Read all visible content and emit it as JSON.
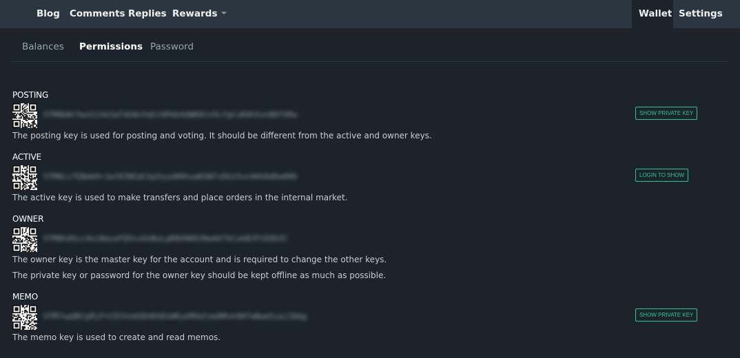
{
  "topnav": {
    "blog": "Blog",
    "comments": "Comments",
    "replies": "Replies",
    "rewards": "Rewards",
    "wallet": "Wallet",
    "settings": "Settings"
  },
  "subnav": {
    "balances": "Balances",
    "permissions": "Permissions",
    "password": "Password"
  },
  "keys": {
    "posting": {
      "title": "POSTING",
      "public_key": "STM8bWr5wn2jhk3aT4kWcVq5J4Pmk4dWK6Cn5LfgCuKHh5sn0DYVRw",
      "desc": "The posting key is used for posting and voting. It should be different from the active and owner keys.",
      "button": "SHOW PRIVATE KEY"
    },
    "active": {
      "title": "ACTIVE",
      "public_key": "STM6Ls7EBdm9rJwtKZWSdCkpVyyeN9huaKSW7sDUz5vn4AhAdDw6R6",
      "desc": "The active key is used to make transfers and place orders in the internal market.",
      "button": "LOGIN TO SHOW"
    },
    "owner": {
      "title": "OWNER",
      "public_key": "STM8h4Scc4oiNazeFQVvvUnBuLgR8VHKD3HwmV7kCukBJFCEQGZC",
      "desc": "The owner key is the master key for the account and is required to change the other keys.",
      "desc2": "The private key or password for the owner key should be kept offline as much as possible."
    },
    "memo": {
      "title": "MEMO",
      "public_key": "STM7xpQKCpRjFtCEChvmSDhKhDxHKyeMXeCom9Mvk9H7aNwmSiaj1Dmg",
      "desc": "The memo key is used to create and read memos.",
      "button": "SHOW PRIVATE KEY"
    }
  },
  "colors": {
    "background": "#1c232b",
    "topnav": "#2c3640",
    "accent": "#20c99b"
  }
}
